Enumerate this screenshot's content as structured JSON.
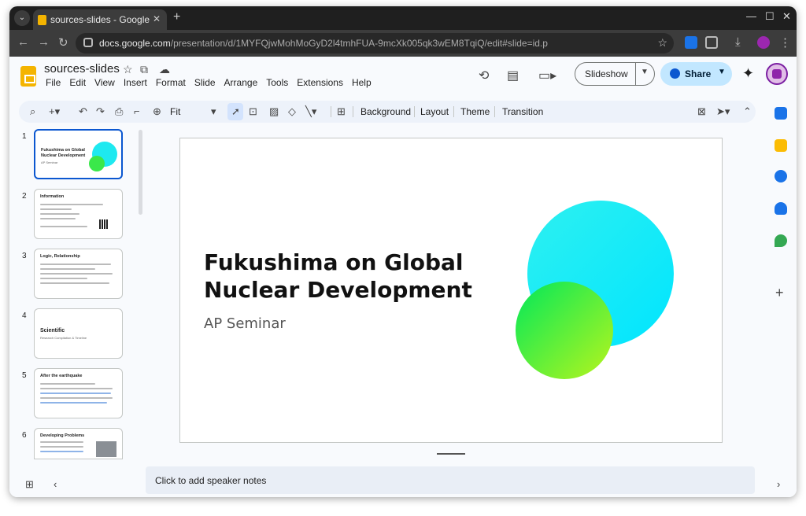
{
  "browser": {
    "tab_title": "sources-slides - Google S",
    "tab_close": "✕",
    "new_tab": "+",
    "url_domain": "docs.google.com",
    "url_path": "/presentation/d/1MYFQjwMohMoGyD2l4tmhFUA-9mcXk005qk3wEM8TqiQ/edit#slide=id.p",
    "icons": [
      "tab-menu-icon",
      "back-icon",
      "forward-icon",
      "reload-icon",
      "site-info-icon",
      "bookmark-star-icon",
      "extension-icon",
      "puzzle-icon",
      "download-icon",
      "profile-icon",
      "more-menu-icon",
      "minimize-icon",
      "maximize-icon",
      "close-icon"
    ]
  },
  "app": {
    "doc_title": "sources-slides",
    "menu": [
      "File",
      "Edit",
      "View",
      "Insert",
      "Format",
      "Slide",
      "Arrange",
      "Tools",
      "Extensions",
      "Help"
    ],
    "slideshow_label": "Slideshow",
    "share_label": "Share",
    "colors": {
      "brand": "#f4b400",
      "accent": "#0b57d0",
      "share_bg": "#c2e7ff"
    }
  },
  "toolbar": {
    "zoom": "Fit",
    "background": "Background",
    "layout": "Layout",
    "theme": "Theme",
    "transition": "Transition"
  },
  "filmstrip": {
    "slides": [
      {
        "num": "1",
        "title": "Fukushima on Global Nuclear Development",
        "sub": "AP Seminar"
      },
      {
        "num": "2",
        "title": "Information"
      },
      {
        "num": "3",
        "title": "Logic, Relationship"
      },
      {
        "num": "4",
        "title": "Scientific",
        "sub": "Research Compilation & Timeline"
      },
      {
        "num": "5",
        "title": "After the earthquake"
      },
      {
        "num": "6",
        "title": "Developing Problems"
      }
    ]
  },
  "slide": {
    "title_line1": "Fukushima on Global",
    "title_line2": "Nuclear Development",
    "subtitle": "AP Seminar"
  },
  "notes": {
    "placeholder": "Click to add speaker notes"
  }
}
